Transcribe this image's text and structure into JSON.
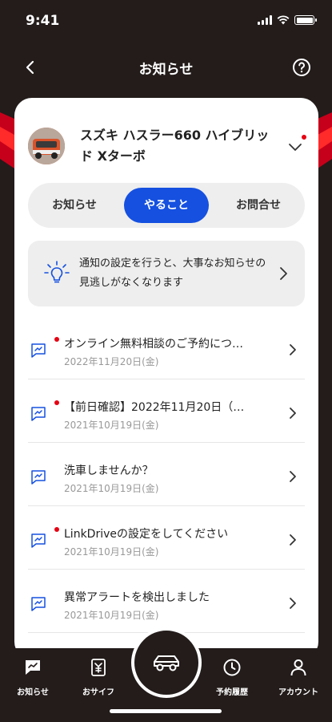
{
  "status_bar": {
    "time": "9:41"
  },
  "nav": {
    "title": "お知らせ"
  },
  "vehicle": {
    "name": "スズキ ハスラー660 ハイブリッド Xターボ"
  },
  "tabs": [
    {
      "label": "お知らせ",
      "active": false
    },
    {
      "label": "やること",
      "active": true
    },
    {
      "label": "お問合せ",
      "active": false
    }
  ],
  "banner": {
    "text": "通知の設定を行うと、大事なお知らせの見逃しがなくなります"
  },
  "notifications": [
    {
      "title": "オンライン無料相談のご予約につ…",
      "date": "2022年11月20日(金)",
      "unread": true
    },
    {
      "title": "【前日確認】2022年11月20日（…",
      "date": "2021年10月19日(金)",
      "unread": true
    },
    {
      "title": "洗車しませんか？",
      "date": "2021年10月19日(金)",
      "unread": false
    },
    {
      "title": "LinkDriveの設定をしてください",
      "date": "2021年10月19日(金)",
      "unread": true
    },
    {
      "title": "異常アラートを検出しました",
      "date": "2021年10月19日(金)",
      "unread": false
    }
  ],
  "bottom_nav": {
    "items": [
      {
        "label": "お知らせ",
        "icon": "message-icon"
      },
      {
        "label": "おサイフ",
        "icon": "wallet-icon"
      },
      {
        "label": "",
        "icon": "car-icon"
      },
      {
        "label": "予約履歴",
        "icon": "clock-icon"
      },
      {
        "label": "アカウント",
        "icon": "person-icon"
      }
    ]
  },
  "colors": {
    "accent": "#1550e0",
    "brand_red": "#e60012",
    "dark_bg": "#231c1b",
    "panel": "#eeeeee"
  }
}
